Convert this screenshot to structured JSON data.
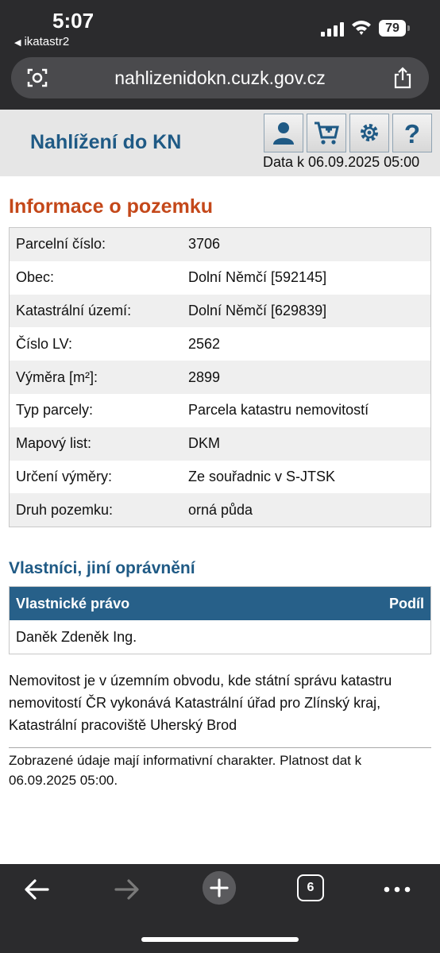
{
  "status": {
    "time": "5:07",
    "back_app": "ikatastr2",
    "battery": "79"
  },
  "browser": {
    "url": "nahlizenidokn.cuzk.gov.cz",
    "tab_count": "6"
  },
  "header": {
    "title": "Nahlížení do KN",
    "date": "Data k 06.09.2025 05:00"
  },
  "section_info": {
    "title": "Informace o pozemku",
    "rows": [
      {
        "key": "Parcelní číslo:",
        "value": "3706"
      },
      {
        "key": "Obec:",
        "value": "Dolní Němčí [592145]"
      },
      {
        "key": "Katastrální území:",
        "value": "Dolní Němčí [629839]"
      },
      {
        "key": "Číslo LV:",
        "value": "2562"
      },
      {
        "key": "Výměra [m²]:",
        "value": "2899"
      },
      {
        "key": "Typ parcely:",
        "value": "Parcela katastru nemovitostí"
      },
      {
        "key": "Mapový list:",
        "value": "DKM"
      },
      {
        "key": "Určení výměry:",
        "value": "Ze souřadnic v S-JTSK"
      },
      {
        "key": "Druh pozemku:",
        "value": "orná půda"
      }
    ]
  },
  "section_owners": {
    "title": "Vlastníci, jiní oprávnění",
    "col_left": "Vlastnické právo",
    "col_right": "Podíl",
    "owner": "Daněk Zdeněk Ing."
  },
  "note": "Nemovitost je v územním obvodu, kde státní správu katastru nemovitostí ČR vykonává Katastrální úřad pro Zlínský kraj, Katastrální pracoviště Uherský Brod",
  "disclaimer": "Zobrazené údaje mají informativní charakter. Platnost dat k 06.09.2025 05:00.",
  "colors": {
    "title_blue": "#1f5a85",
    "heading_orange": "#c4481a",
    "table_head": "#276089"
  }
}
